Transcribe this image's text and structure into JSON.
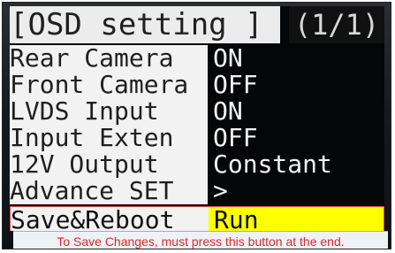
{
  "screen": {
    "title": "[OSD setting ]",
    "page_indicator": "(1/1)"
  },
  "menu": {
    "items": [
      {
        "label": "Rear Camera",
        "value": "ON"
      },
      {
        "label": "Front Camera",
        "value": "OFF"
      },
      {
        "label": "LVDS Input",
        "value": "ON"
      },
      {
        "label": "Input Exten",
        "value": "OFF"
      },
      {
        "label": "12V Output",
        "value": "Constant"
      },
      {
        "label": "Advance SET",
        "value": ">"
      }
    ],
    "selected": {
      "label": "Save&Reboot",
      "value": "Run"
    }
  },
  "annotation": {
    "text": "To Save Changes, must press this button at the end."
  },
  "colors": {
    "screen_bg": "#050607",
    "label_bg": "#f2f2f2",
    "selected_value_bg": "#ffff00",
    "annotation_text": "#d42b2b"
  }
}
